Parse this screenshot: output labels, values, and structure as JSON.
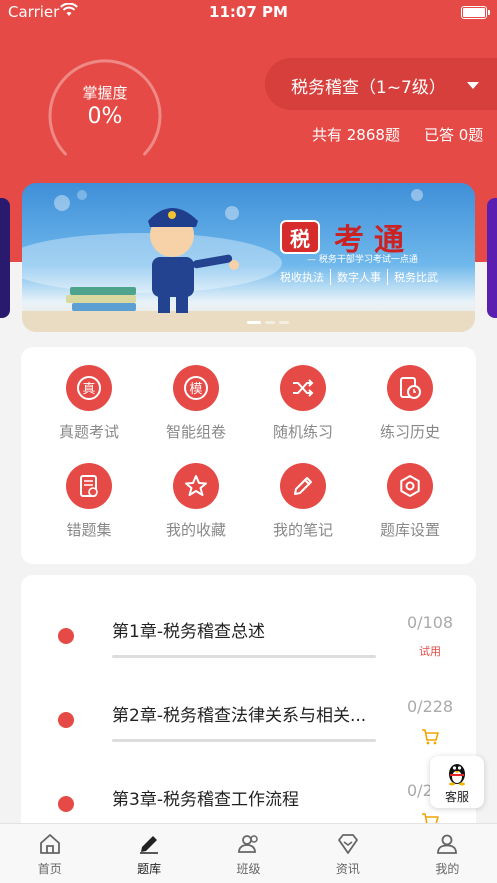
{
  "status_bar": {
    "carrier": "Carrier",
    "time": "11:07 PM"
  },
  "mastery": {
    "label": "掌握度",
    "value": "0%",
    "percent": 0
  },
  "bank_selector": {
    "label": "税务稽查（1~7级）"
  },
  "stats": {
    "total": "共有 2868题",
    "answered": "已答 0题"
  },
  "banner": {
    "seal": "税",
    "brand_name": "考通",
    "slogan": "— 税务干部学习考试一点通",
    "tags": [
      "税收执法",
      "数字人事",
      "税务比武"
    ]
  },
  "menu": [
    {
      "label": "真题考试",
      "icon": "exam-icon"
    },
    {
      "label": "智能组卷",
      "icon": "mock-paper-icon"
    },
    {
      "label": "随机练习",
      "icon": "shuffle-icon"
    },
    {
      "label": "练习历史",
      "icon": "history-icon"
    },
    {
      "label": "错题集",
      "icon": "wrong-questions-icon"
    },
    {
      "label": "我的收藏",
      "icon": "star-icon"
    },
    {
      "label": "我的笔记",
      "icon": "pencil-icon"
    },
    {
      "label": "题库设置",
      "icon": "settings-icon"
    }
  ],
  "chapters": [
    {
      "title": "第1章-税务稽查总述",
      "count": "0/108",
      "badge": "试用",
      "progress": 0
    },
    {
      "title": "第2章-税务稽查法律关系与相关...",
      "count": "0/228",
      "badge_icon": "cart-icon",
      "progress": 0
    },
    {
      "title": "第3章-税务稽查工作流程",
      "count": "0/2",
      "badge_icon": "cart-icon",
      "progress": 0
    }
  ],
  "service": {
    "label": "客服"
  },
  "tabs": [
    {
      "label": "首页",
      "icon": "home-icon"
    },
    {
      "label": "题库",
      "icon": "pencil-icon",
      "active": true
    },
    {
      "label": "班级",
      "icon": "class-icon"
    },
    {
      "label": "资讯",
      "icon": "news-icon"
    },
    {
      "label": "我的",
      "icon": "profile-icon"
    }
  ],
  "colors": {
    "primary": "#e64a46",
    "selector_bg": "#d63f3b",
    "text_muted": "#888888"
  }
}
